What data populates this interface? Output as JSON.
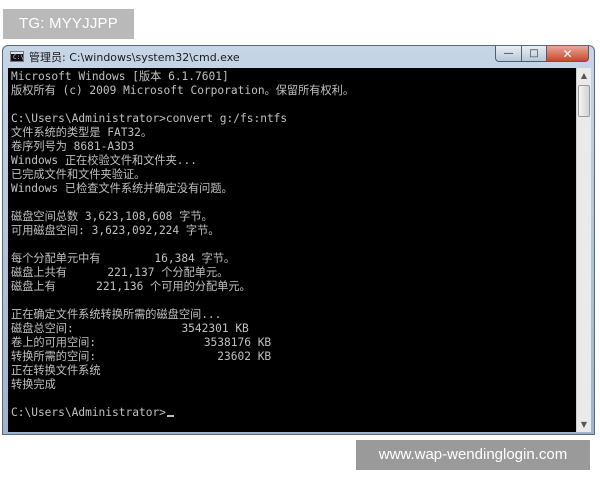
{
  "overlay": {
    "tag": "TG: MYYJJPP",
    "watermark": "www.wap-wendinglogin.com"
  },
  "window": {
    "title": "管理员: C:\\windows\\system32\\cmd.exe",
    "icon": "cmd-icon",
    "icon_glyph": "C:\\",
    "controls": {
      "minimize": "—",
      "maximize": "□",
      "close": "✕"
    }
  },
  "console": {
    "text_color": "#c0c0c0",
    "background": "#000000",
    "lines": [
      "Microsoft Windows [版本 6.1.7601]",
      "版权所有 (c) 2009 Microsoft Corporation。保留所有权利。",
      "",
      "C:\\Users\\Administrator>convert g:/fs:ntfs",
      "文件系统的类型是 FAT32。",
      "卷序列号为 8681-A3D3",
      "Windows 正在校验文件和文件夹...",
      "已完成文件和文件夹验证。",
      "Windows 已检查文件系统并确定没有问题。",
      "",
      "磁盘空间总数 3,623,108,608 字节。",
      "可用磁盘空间: 3,623,092,224 字节。",
      "",
      "每个分配单元中有        16,384 字节。",
      "磁盘上共有      221,137 个分配单元。",
      "磁盘上有      221,136 个可用的分配单元。",
      "",
      "正在确定文件系统转换所需的磁盘空间...",
      "磁盘总空间:                3542301 KB",
      "卷上的可用空间:                3538176 KB",
      "转换所需的空间:                  23602 KB",
      "正在转换文件系统",
      "转换完成",
      "",
      "C:\\Users\\Administrator>"
    ]
  },
  "scrollbar": {
    "up_arrow": "▲",
    "down_arrow": "▼"
  }
}
